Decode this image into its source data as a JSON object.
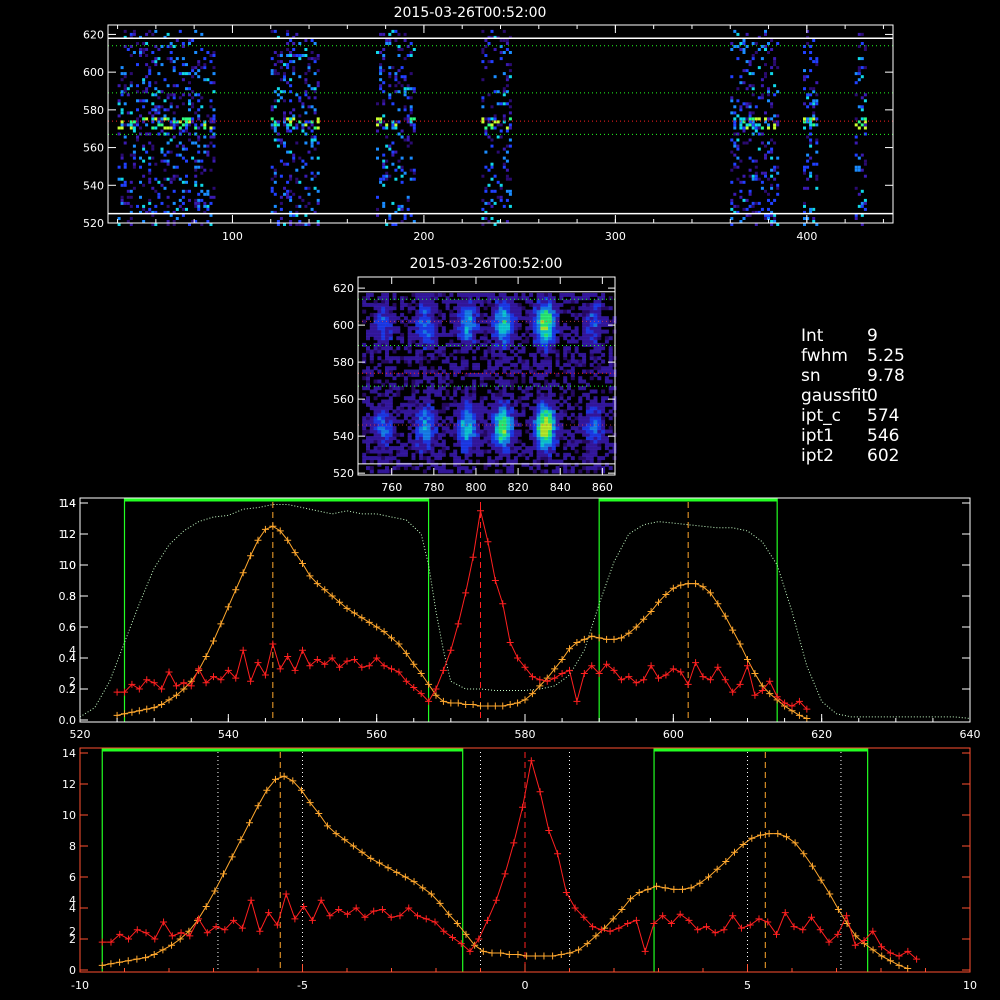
{
  "colors": {
    "background": "#000000",
    "axis": "#ffffff",
    "orange_series": "#ffa82e",
    "red_series": "#ff2020",
    "green_window": "#22ff22",
    "green_spectrum": "#c8ffc8"
  },
  "info": [
    {
      "key": "Int",
      "value": "9"
    },
    {
      "key": "fwhm",
      "value": "5.25"
    },
    {
      "key": "sn",
      "value": "9.78"
    },
    {
      "key": "gaussfit",
      "value": "0"
    },
    {
      "key": "ipt_c",
      "value": "574"
    },
    {
      "key": "ipt1",
      "value": "546"
    },
    {
      "key": "ipt2",
      "value": "602"
    }
  ],
  "chart_data": [
    {
      "id": "slit-image",
      "type": "heatmap",
      "title": "2015-03-26T00:52:00",
      "xlim": [
        35,
        445
      ],
      "ylim": [
        520,
        625
      ],
      "xticks": [
        100,
        200,
        300,
        400
      ],
      "yticks": [
        520,
        540,
        560,
        580,
        600,
        620
      ],
      "signal_columns": [
        [
          40,
          90
        ],
        [
          120,
          145
        ],
        [
          175,
          195
        ],
        [
          230,
          245
        ],
        [
          360,
          385
        ],
        [
          398,
          405
        ],
        [
          425,
          430
        ]
      ],
      "hlines_white": [
        525,
        618
      ],
      "hlines_green": [
        567,
        589,
        614
      ],
      "hline_red": 574
    },
    {
      "id": "zoom-image",
      "type": "heatmap",
      "title": "2015-03-26T00:52:00",
      "xlim": [
        744,
        866
      ],
      "ylim": [
        519,
        626
      ],
      "xticks": [
        760,
        780,
        800,
        820,
        840,
        860
      ],
      "yticks": [
        520,
        540,
        560,
        580,
        600,
        620
      ],
      "blobs_x": [
        755,
        775,
        795,
        812,
        832,
        855
      ],
      "blobs_y": [
        546,
        602
      ],
      "hlines_green": [
        567,
        589,
        614
      ],
      "hline_red": 574
    },
    {
      "id": "profile-pixel",
      "type": "line",
      "xlim": [
        520,
        640
      ],
      "ylim": [
        0,
        1.4
      ],
      "yticks_left_white": [
        0.0,
        0.2,
        0.4,
        0.6,
        0.8,
        1.0,
        1.2,
        1.4
      ],
      "yticks_left_orange": [
        2,
        4,
        6,
        8,
        10,
        12,
        14
      ],
      "yticks_left_red": [
        2,
        4
      ],
      "xticks": [
        520,
        540,
        560,
        580,
        600,
        620,
        640
      ],
      "green_windows": [
        [
          526,
          567
        ],
        [
          590,
          614
        ]
      ],
      "vlines_dashed": [
        546,
        574,
        602
      ],
      "series": [
        {
          "id": "orange",
          "x": [
            525,
            526,
            527,
            528,
            529,
            530,
            531,
            532,
            533,
            534,
            535,
            536,
            537,
            538,
            539,
            540,
            541,
            542,
            543,
            544,
            545,
            546,
            547,
            548,
            549,
            550,
            551,
            552,
            553,
            554,
            555,
            556,
            557,
            558,
            559,
            560,
            561,
            562,
            563,
            564,
            565,
            566,
            567,
            568,
            569,
            570,
            571,
            572,
            573,
            574,
            575,
            576,
            577,
            578,
            579,
            580,
            581,
            582,
            583,
            584,
            585,
            586,
            587,
            588,
            589,
            590,
            591,
            592,
            593,
            594,
            595,
            596,
            597,
            598,
            599,
            600,
            601,
            602,
            603,
            604,
            605,
            606,
            607,
            608,
            609,
            610,
            611,
            612,
            613,
            614,
            615,
            616,
            617,
            618
          ],
          "y": [
            0.3,
            0.4,
            0.5,
            0.6,
            0.7,
            0.8,
            1.0,
            1.3,
            1.6,
            2.0,
            2.5,
            3.2,
            4.1,
            5.1,
            6.2,
            7.3,
            8.4,
            9.5,
            10.6,
            11.6,
            12.3,
            12.5,
            12.2,
            11.6,
            10.8,
            10.1,
            9.3,
            8.8,
            8.4,
            8.0,
            7.6,
            7.2,
            6.9,
            6.6,
            6.3,
            6.0,
            5.7,
            5.3,
            4.9,
            4.3,
            3.6,
            3.0,
            2.3,
            1.6,
            1.2,
            1.1,
            1.1,
            1.0,
            1.0,
            0.9,
            0.9,
            0.9,
            0.9,
            1.0,
            1.1,
            1.3,
            1.7,
            2.2,
            2.7,
            3.3,
            3.9,
            4.6,
            5.0,
            5.2,
            5.4,
            5.3,
            5.2,
            5.2,
            5.3,
            5.6,
            6.0,
            6.5,
            7.0,
            7.6,
            8.1,
            8.5,
            8.7,
            8.8,
            8.8,
            8.6,
            8.2,
            7.5,
            6.7,
            5.8,
            4.9,
            3.9,
            3.0,
            2.2,
            1.7,
            1.3,
            0.9,
            0.6,
            0.3,
            0.1
          ]
        },
        {
          "id": "red",
          "x": [
            525,
            526,
            527,
            528,
            529,
            530,
            531,
            532,
            533,
            534,
            535,
            536,
            537,
            538,
            539,
            540,
            541,
            542,
            543,
            544,
            545,
            546,
            547,
            548,
            549,
            550,
            551,
            552,
            553,
            554,
            555,
            556,
            557,
            558,
            559,
            560,
            561,
            562,
            563,
            564,
            565,
            566,
            567,
            568,
            569,
            570,
            571,
            572,
            573,
            574,
            575,
            576,
            577,
            578,
            579,
            580,
            581,
            582,
            583,
            584,
            585,
            586,
            587,
            588,
            589,
            590,
            591,
            592,
            593,
            594,
            595,
            596,
            597,
            598,
            599,
            600,
            601,
            602,
            603,
            604,
            605,
            606,
            607,
            608,
            609,
            610,
            611,
            612,
            613,
            614,
            615,
            616,
            617,
            618
          ],
          "y": [
            1.8,
            1.8,
            2.3,
            2.0,
            2.6,
            2.4,
            2.0,
            3.1,
            2.2,
            2.4,
            2.2,
            3.3,
            2.4,
            2.8,
            2.6,
            3.2,
            2.7,
            4.5,
            2.5,
            3.7,
            2.9,
            4.9,
            3.3,
            4.1,
            3.2,
            4.5,
            3.5,
            3.9,
            3.6,
            4.0,
            3.4,
            3.8,
            3.9,
            3.4,
            3.5,
            4.0,
            3.5,
            3.3,
            3.1,
            2.5,
            2.1,
            1.7,
            1.2,
            2.0,
            3.2,
            4.5,
            6.2,
            8.2,
            10.5,
            13.5,
            11.5,
            9.0,
            7.5,
            5.0,
            4.0,
            3.4,
            2.8,
            2.6,
            2.5,
            2.7,
            3.0,
            3.2,
            1.2,
            3.0,
            3.5,
            3.0,
            3.6,
            3.2,
            2.6,
            2.8,
            2.4,
            2.6,
            3.5,
            2.7,
            2.9,
            3.3,
            3.1,
            2.3,
            3.7,
            2.8,
            2.6,
            3.4,
            2.6,
            1.8,
            2.3,
            3.5,
            1.6,
            1.9,
            2.5,
            1.5,
            1.1,
            0.9,
            1.2,
            0.7
          ]
        },
        {
          "id": "green-spectrum",
          "x": [
            520,
            522,
            524,
            526,
            528,
            530,
            532,
            534,
            536,
            538,
            540,
            542,
            544,
            546,
            548,
            550,
            552,
            554,
            556,
            558,
            560,
            562,
            564,
            566,
            567,
            568,
            569,
            570,
            572,
            574,
            576,
            578,
            580,
            582,
            584,
            586,
            588,
            590,
            592,
            594,
            596,
            598,
            600,
            602,
            604,
            606,
            608,
            610,
            612,
            614,
            616,
            618,
            620,
            622,
            624,
            626,
            628,
            630,
            632,
            634,
            636,
            638,
            640
          ],
          "y": [
            0.02,
            0.08,
            0.25,
            0.5,
            0.75,
            0.98,
            1.13,
            1.22,
            1.28,
            1.31,
            1.32,
            1.36,
            1.37,
            1.39,
            1.39,
            1.37,
            1.35,
            1.33,
            1.35,
            1.33,
            1.33,
            1.31,
            1.29,
            1.2,
            1.0,
            0.7,
            0.45,
            0.25,
            0.2,
            0.2,
            0.19,
            0.19,
            0.19,
            0.2,
            0.22,
            0.29,
            0.45,
            0.75,
            1.02,
            1.2,
            1.26,
            1.28,
            1.27,
            1.26,
            1.25,
            1.24,
            1.24,
            1.22,
            1.15,
            1.0,
            0.7,
            0.35,
            0.12,
            0.04,
            0.02,
            0.02,
            0.02,
            0.02,
            0.02,
            0.02,
            0.02,
            0.02,
            0.01
          ]
        }
      ]
    },
    {
      "id": "profile-velocity",
      "type": "line",
      "xlim": [
        -10,
        10
      ],
      "ylim": [
        0,
        14
      ],
      "xticks": [
        -10,
        -5,
        0,
        5,
        10
      ],
      "yticks_left_orange": [
        0,
        2,
        4,
        6,
        8,
        10,
        12,
        14
      ],
      "yticks_left_red": [
        2,
        4
      ],
      "green_windows": [
        [
          -9.5,
          -1.4
        ],
        [
          2.9,
          7.7
        ]
      ],
      "vlines_dotted": [
        -6.9,
        -5.0,
        -1.0,
        1.0,
        5.0,
        7.1
      ],
      "vlines_dashed": [
        -5.5,
        0,
        5.4
      ],
      "orange_x": [
        -9.5,
        8.6
      ],
      "red_x": [
        -9.5,
        8.8
      ]
    }
  ]
}
